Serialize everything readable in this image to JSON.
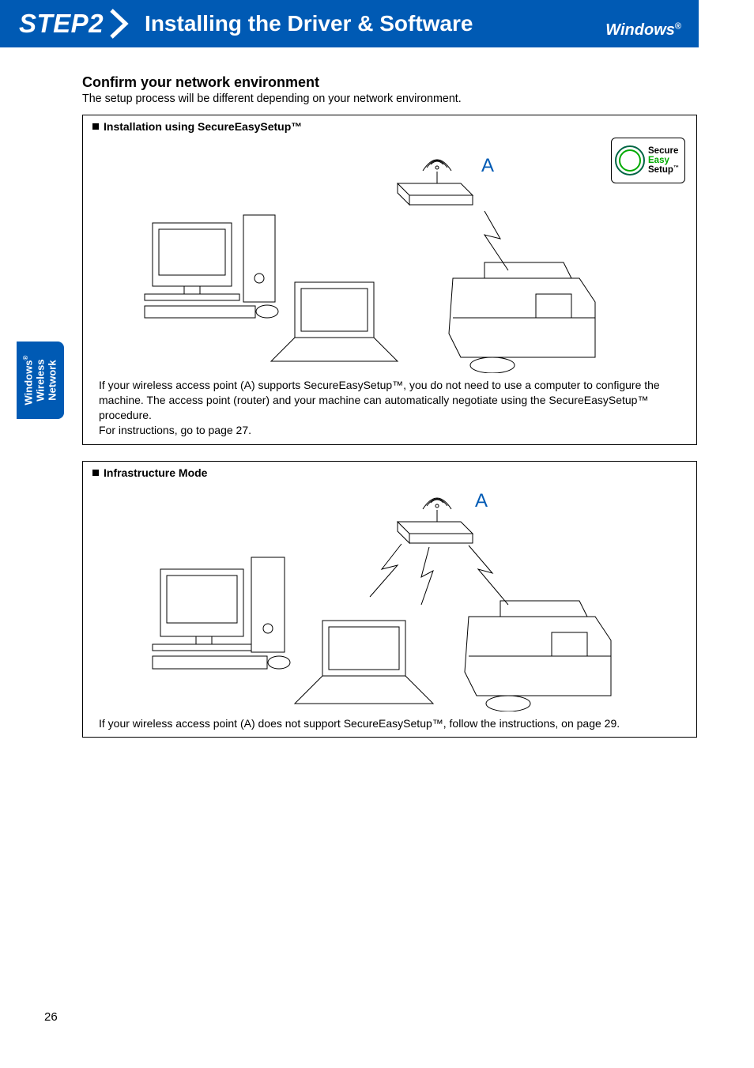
{
  "header": {
    "step": "STEP2",
    "title": "Installing the Driver & Software",
    "os": "Windows",
    "os_reg": "®"
  },
  "section": {
    "heading": "Confirm your network environment",
    "sub": "The setup process will be different depending on your network environment."
  },
  "box1": {
    "title": "Installation using SecureEasySetup™",
    "label_a": "A",
    "ses_logo": {
      "line1": "Secure",
      "line2": "Easy",
      "line3": "Setup",
      "tm": "™"
    },
    "body_l1": "If your wireless access point (A) supports SecureEasySetup™, you do not need to use a computer to configure the",
    "body_l2": "machine. The access point (router) and your machine can automatically negotiate using the SecureEasySetup™",
    "body_l3": "procedure.",
    "body_l4": "For instructions, go to page 27."
  },
  "box2": {
    "title": "Infrastructure Mode",
    "label_a": "A",
    "body": "If your wireless access point (A) does not support SecureEasySetup™, follow the instructions, on page 29."
  },
  "side_tab": {
    "line1": "Windows",
    "reg": "®",
    "line2": "Wireless",
    "line3": "Network"
  },
  "page_number": "26"
}
